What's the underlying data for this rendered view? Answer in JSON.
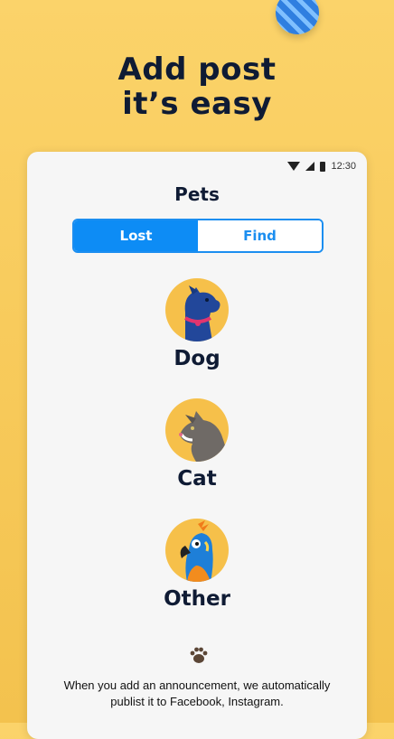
{
  "headline": {
    "line1": "Add post",
    "line2": "it’s easy"
  },
  "status_bar": {
    "time": "12:30"
  },
  "screen": {
    "title": "Pets",
    "tabs": [
      {
        "label": "Lost",
        "selected": true
      },
      {
        "label": "Find",
        "selected": false
      }
    ],
    "categories": [
      {
        "label": "Dog",
        "icon": "dog-icon"
      },
      {
        "label": "Cat",
        "icon": "cat-icon"
      },
      {
        "label": "Other",
        "icon": "parrot-icon"
      }
    ],
    "footer_icon": "paw-icon",
    "note": "When you add an announcement, we automatically publist it to Facebook, Instagram."
  },
  "colors": {
    "background": "#f8cb5c",
    "primary_blue": "#0d8cf5",
    "navy_text": "#0f1b34",
    "avatar_circle": "#f6c04a"
  }
}
